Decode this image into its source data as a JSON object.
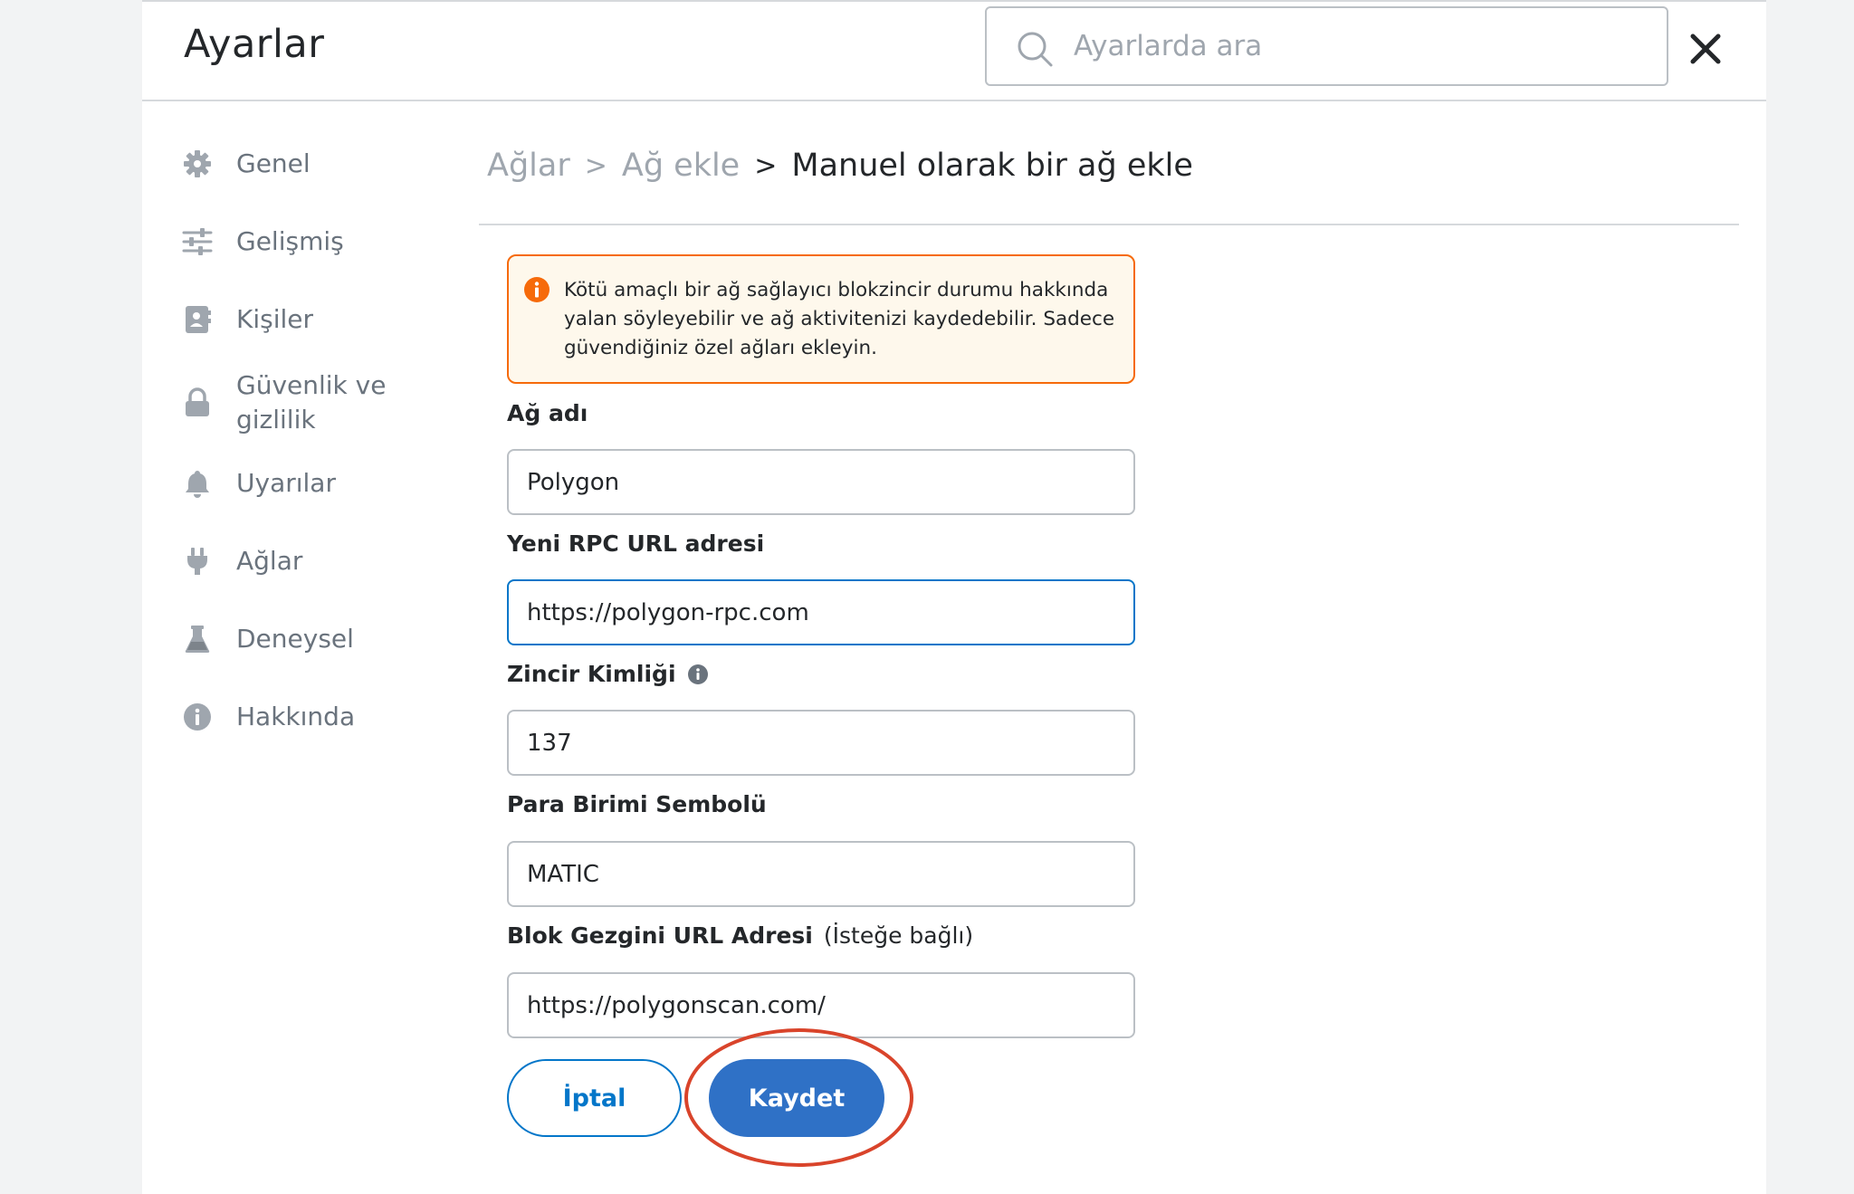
{
  "header": {
    "title": "Ayarlar",
    "search_placeholder": "Ayarlarda ara"
  },
  "sidebar": {
    "items": [
      {
        "label": "Genel",
        "icon": "gear-icon"
      },
      {
        "label": "Gelişmiş",
        "icon": "sliders-icon"
      },
      {
        "label": "Kişiler",
        "icon": "contact-book-icon"
      },
      {
        "label": "Güvenlik ve gizlilik",
        "icon": "lock-icon"
      },
      {
        "label": "Uyarılar",
        "icon": "bell-icon"
      },
      {
        "label": "Ağlar",
        "icon": "plug-icon"
      },
      {
        "label": "Deneysel",
        "icon": "flask-icon"
      },
      {
        "label": "Hakkında",
        "icon": "info-icon"
      }
    ]
  },
  "breadcrumb": {
    "items": [
      "Ağlar",
      "Ağ ekle"
    ],
    "current": "Manuel olarak bir ağ ekle",
    "separator": ">"
  },
  "warning": {
    "text": "Kötü amaçlı bir ağ sağlayıcı blokzincir durumu hakkında yalan söyleyebilir ve ağ aktivitenizi kaydedebilir. Sadece güvendiğiniz özel ağları ekleyin.",
    "color": "#f66a0a"
  },
  "form": {
    "network_name": {
      "label": "Ağ adı",
      "value": "Polygon"
    },
    "rpc_url": {
      "label": "Yeni RPC URL adresi",
      "value": "https://polygon-rpc.com"
    },
    "chain_id": {
      "label": "Zincir Kimliği",
      "value": "137"
    },
    "currency_symbol": {
      "label": "Para Birimi Sembolü",
      "value": "MATIC"
    },
    "explorer_url": {
      "label": "Blok Gezgini URL Adresi",
      "optional": "(İsteğe bağlı)",
      "value": "https://polygonscan.com/"
    }
  },
  "buttons": {
    "cancel": "İptal",
    "save": "Kaydet"
  },
  "colors": {
    "accent": "#0376c9",
    "primary_button": "#2f71c6",
    "highlight_ring": "#d9442b"
  }
}
